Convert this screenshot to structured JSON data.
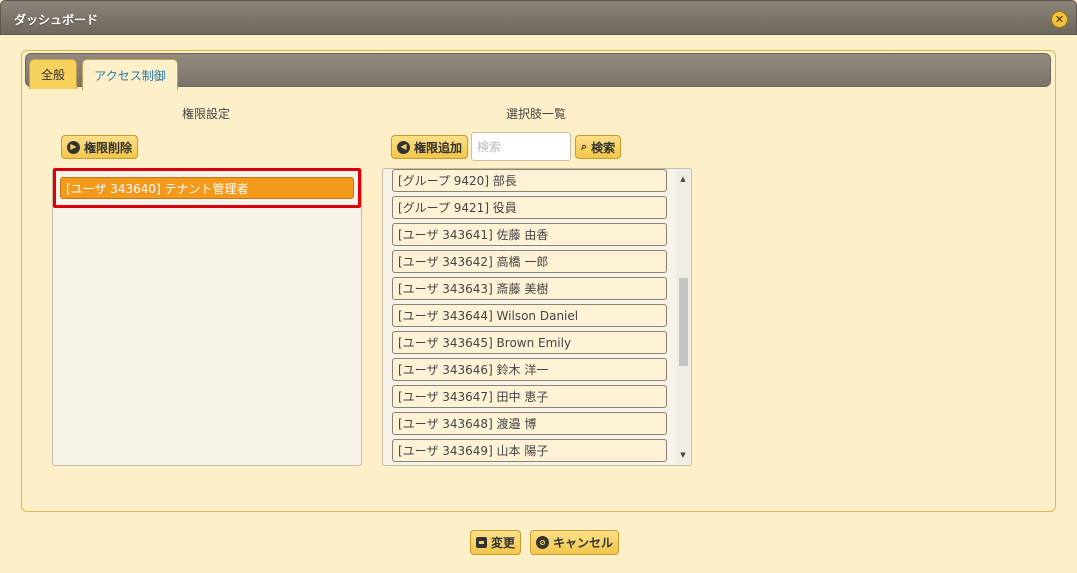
{
  "window": {
    "title": "ダッシュボード",
    "close_label": "✕"
  },
  "tabs": [
    {
      "label": "全般",
      "active": false
    },
    {
      "label": "アクセス制御",
      "active": true
    }
  ],
  "left": {
    "heading": "権限設定",
    "remove_button": "権限削除",
    "items": [
      "[ユーザ 343640] テナント管理者"
    ]
  },
  "right": {
    "heading": "選択肢一覧",
    "add_button": "権限追加",
    "search_placeholder": "検索",
    "search_value": "",
    "search_button": "検索",
    "items": [
      "[グループ 9420] 部長",
      "[グループ 9421] 役員",
      "[ユーザ 343641] 佐藤 由香",
      "[ユーザ 343642] 高橋 一郎",
      "[ユーザ 343643] 斎藤 美樹",
      "[ユーザ 343644] Wilson Daniel",
      "[ユーザ 343645] Brown Emily",
      "[ユーザ 343646] 鈴木 洋一",
      "[ユーザ 343647] 田中 恵子",
      "[ユーザ 343648] 渡邉 博",
      "[ユーザ 343649] 山本 陽子"
    ]
  },
  "footer": {
    "change_button": "変更",
    "cancel_button": "キャンセル"
  },
  "colors": {
    "accent": "#f39a1c",
    "highlight": "#e0000b",
    "button": "#f2c64a"
  }
}
